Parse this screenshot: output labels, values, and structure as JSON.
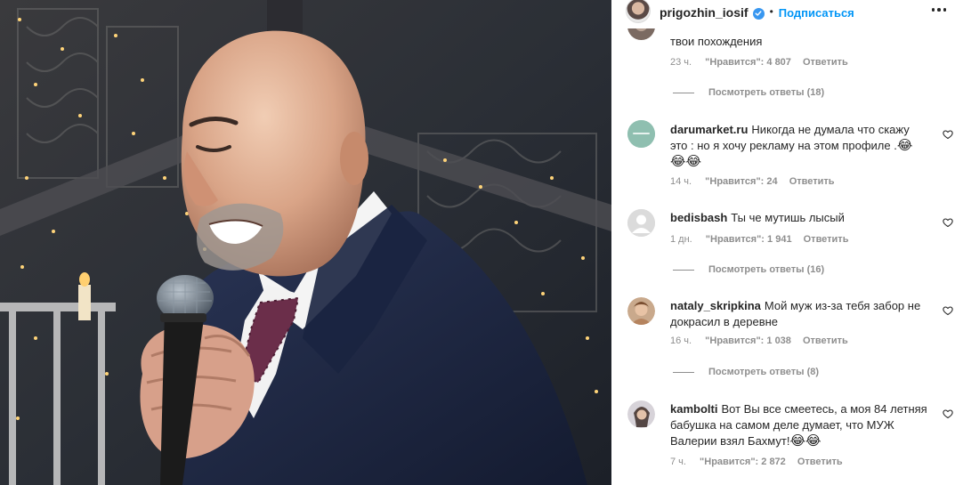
{
  "post": {
    "author": "prigozhin_iosif",
    "separator": "•",
    "follow_label": "Подписаться"
  },
  "partial_comment": {
    "text": "твои похождения",
    "time": "23 ч.",
    "likes": "\"Нравится\": 4 807",
    "reply_label": "Ответить",
    "view_replies": "Посмотреть ответы (18)"
  },
  "comments": [
    {
      "username": "darumarket.ru",
      "text": "Никогда не думала что скажу это : но я хочу рекламу на этом профиле .",
      "emoji_inline": "😂",
      "emoji_line": "😂😂",
      "time": "14 ч.",
      "likes": "\"Нравится\": 24",
      "reply_label": "Ответить"
    },
    {
      "username": "bedisbash",
      "text": "Ты че мутишь лысый",
      "time": "1 дн.",
      "likes": "\"Нравится\": 1 941",
      "reply_label": "Ответить",
      "view_replies": "Посмотреть ответы (16)"
    },
    {
      "username": "nataly_skripkina",
      "text": "Мой муж из-за тебя забор не докрасил в деревне",
      "time": "16 ч.",
      "likes": "\"Нравится\": 1 038",
      "reply_label": "Ответить",
      "view_replies": "Посмотреть ответы (8)"
    },
    {
      "username": "kambolti",
      "text": "Вот Вы все смеетесь, а моя 84 летняя бабушка на самом деле думает, что МУЖ Валерии взял Бахмут!",
      "emoji_inline": "😂😂",
      "time": "7 ч.",
      "likes": "\"Нравится\": 2 872",
      "reply_label": "Ответить"
    }
  ],
  "colors": {
    "link_blue": "#0095f6",
    "verified_blue": "#3897f0",
    "meta_gray": "#8e8e8e",
    "text": "#262626",
    "suit_navy": "#1f2a48"
  },
  "icons": [
    "verified-badge-icon",
    "more-options-icon",
    "heart-icon",
    "microphone-icon"
  ]
}
